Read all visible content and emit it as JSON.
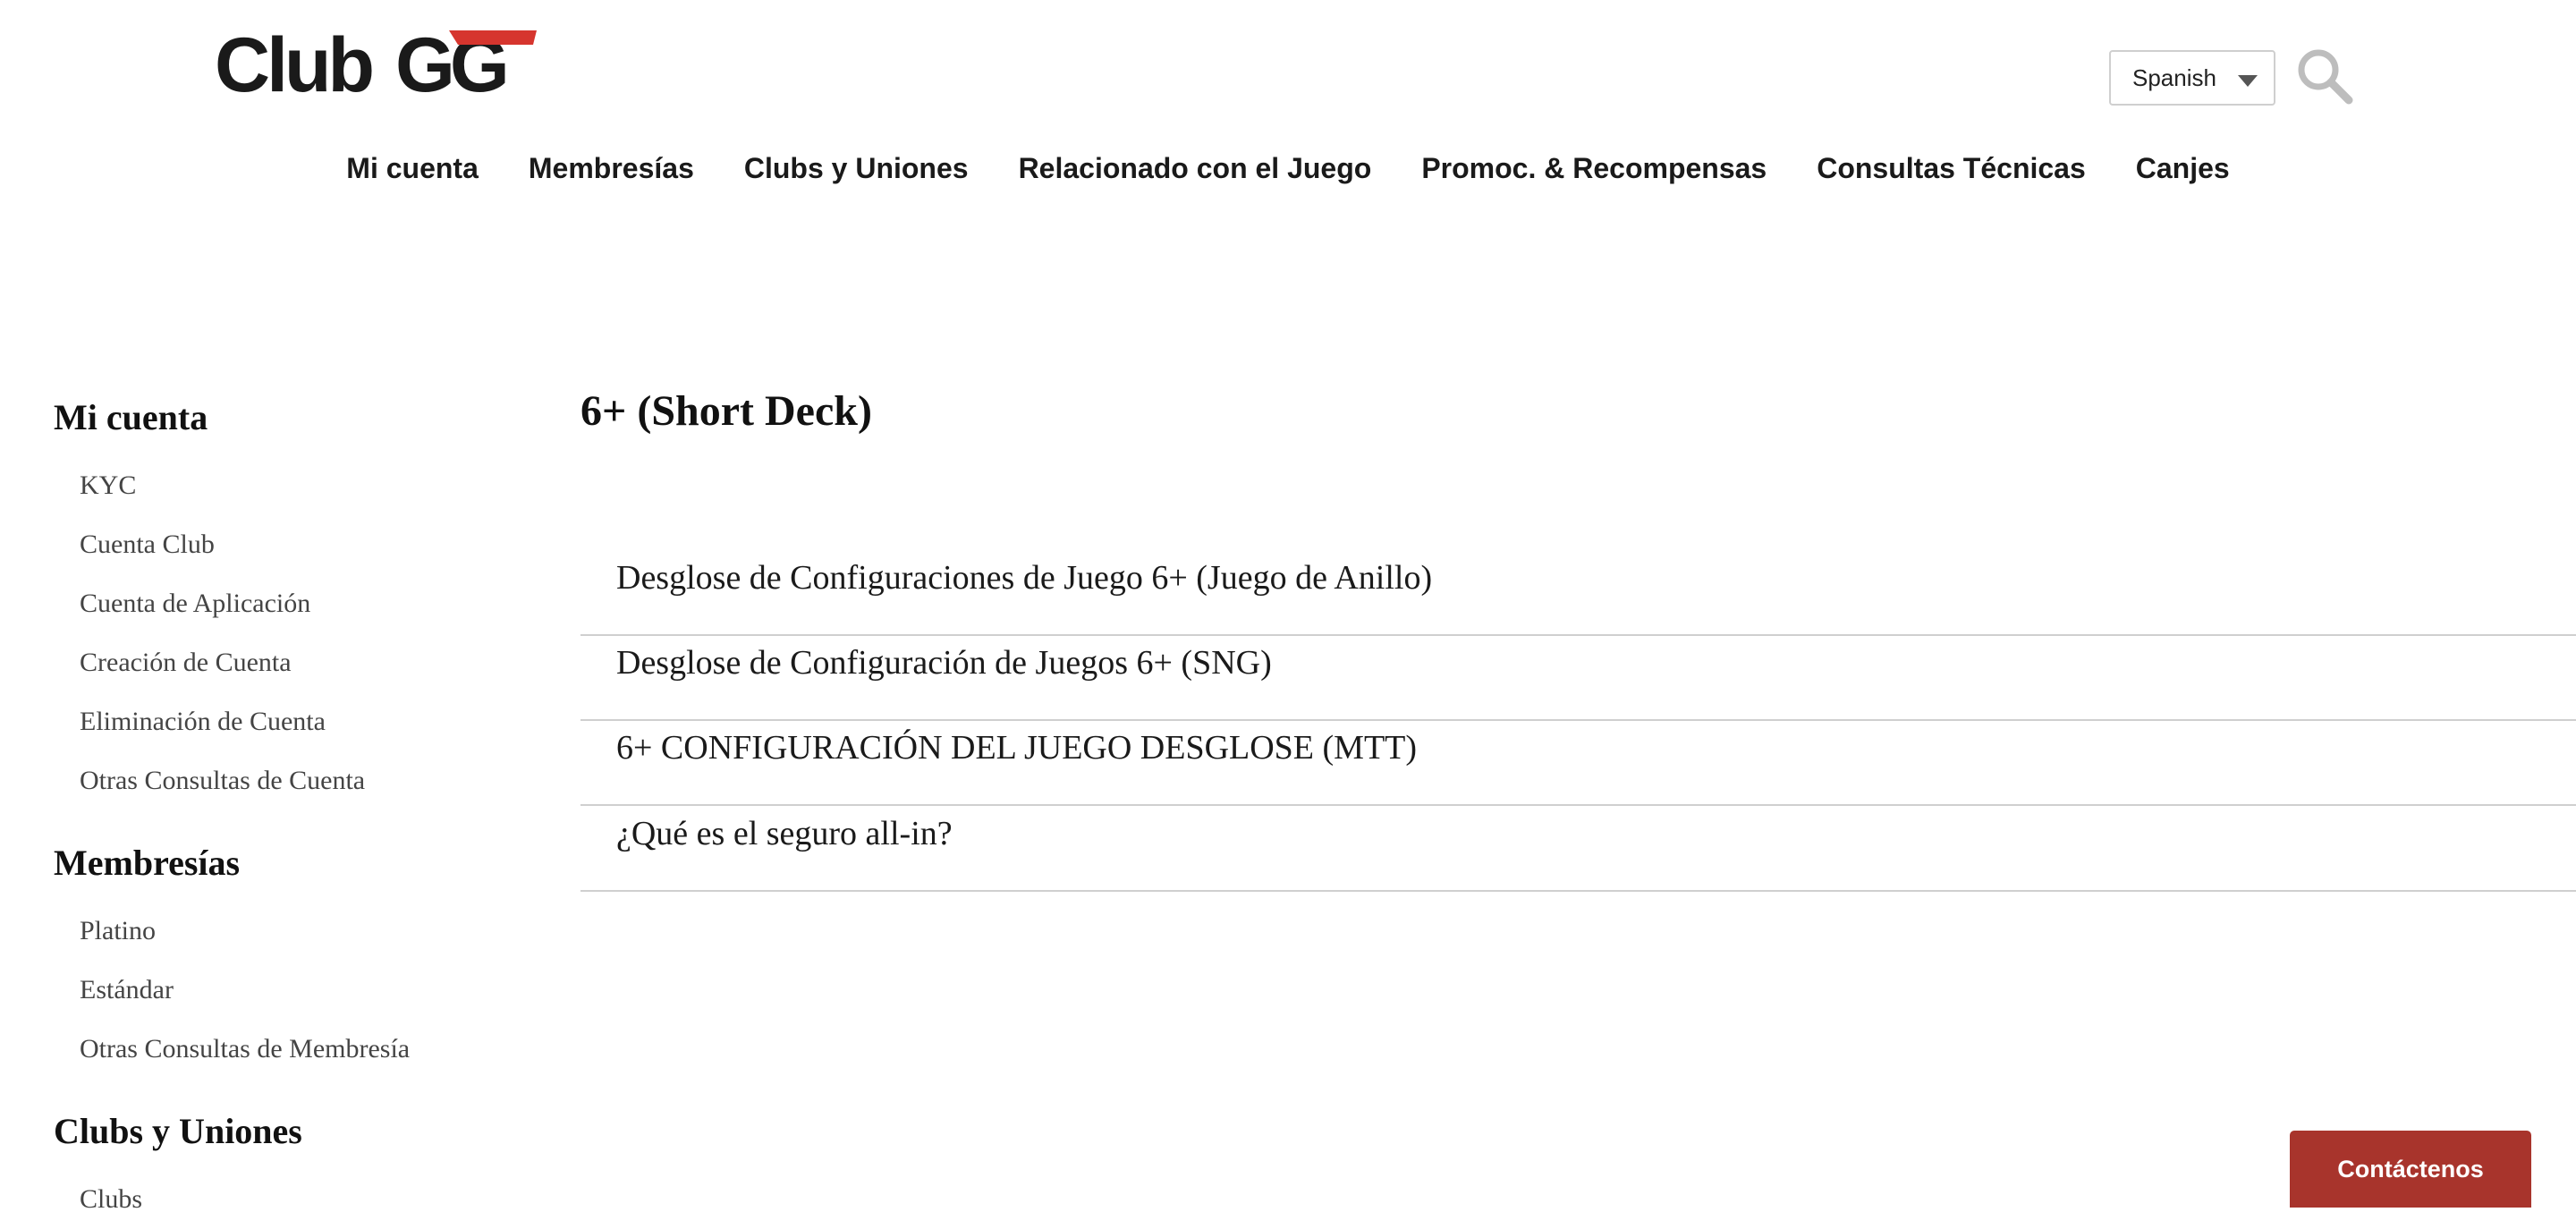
{
  "brand": {
    "logo_text": "ClubGG",
    "accent_color": "#d6352e"
  },
  "header": {
    "language": {
      "selected": "Spanish"
    },
    "search_icon": "search-icon"
  },
  "nav": {
    "items": [
      "Mi cuenta",
      "Membresías",
      "Clubs y Uniones",
      "Relacionado con el Juego",
      "Promoc. & Recompensas",
      "Consultas Técnicas",
      "Canjes"
    ]
  },
  "sidebar": {
    "sections": [
      {
        "title": "Mi cuenta",
        "items": [
          "KYC",
          "Cuenta Club",
          "Cuenta de Aplicación",
          "Creación de Cuenta",
          "Eliminación de Cuenta",
          "Otras Consultas de Cuenta"
        ]
      },
      {
        "title": "Membresías",
        "items": [
          "Platino",
          "Estándar",
          "Otras Consultas de Membresía"
        ]
      },
      {
        "title": "Clubs y Uniones",
        "items": [
          "Clubs"
        ]
      }
    ]
  },
  "main": {
    "title": "6+ (Short Deck)",
    "articles": [
      "Desglose de Configuraciones de Juego 6+ (Juego de Anillo)",
      "Desglose de Configuración de Juegos 6+ (SNG)",
      "6+ CONFIGURACIÓN DEL JUEGO DESGLOSE (MTT)",
      "¿Qué es el seguro all-in?"
    ]
  },
  "contact": {
    "label": "Contáctenos",
    "color": "#a8342c"
  }
}
